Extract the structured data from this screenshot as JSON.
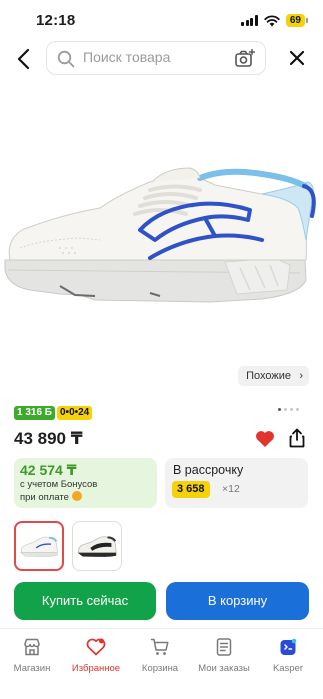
{
  "status_bar": {
    "time": "12:18",
    "battery": "69"
  },
  "search": {
    "placeholder": "Поиск товара"
  },
  "similar": {
    "label": "Похожие",
    "chevron": "›"
  },
  "badges": {
    "bonus": "1 316 Б",
    "installment": "0•0•24"
  },
  "price": "43 890 ₸",
  "bonus_card": {
    "price": "42 574 ₸",
    "desc_line1": "с учетом Бонусов",
    "desc_line2": "при оплате"
  },
  "installment_card": {
    "label": "В рассрочку",
    "amount": "3 658",
    "times": "×12"
  },
  "buttons": {
    "buy_now": "Купить сейчас",
    "add_to_cart": "В корзину"
  },
  "nav": {
    "items": [
      {
        "label": "Магазин",
        "icon": "store-icon"
      },
      {
        "label": "Избранное",
        "icon": "heart-icon"
      },
      {
        "label": "Корзина",
        "icon": "cart-icon"
      },
      {
        "label": "Мои заказы",
        "icon": "orders-icon"
      },
      {
        "label": "Kasper",
        "icon": "kasper-icon"
      }
    ]
  },
  "colors": {
    "accent_red": "#e0342c",
    "buy_green": "#12a24a",
    "cart_blue": "#1a6fd9",
    "installment_yellow": "#f5d20a"
  }
}
